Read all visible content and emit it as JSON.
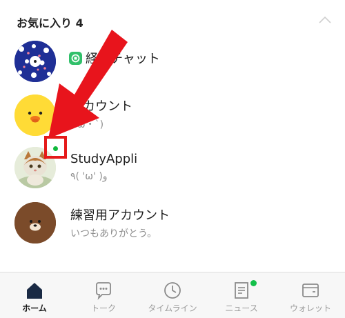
{
  "favorites": {
    "title": "お気に入り 4",
    "collapse_icon": "chevron-up-icon"
  },
  "friends": [
    {
      "name": "経験チャット",
      "status": "",
      "avatar": "pattern-avatar"
    },
    {
      "name": "アカウント",
      "status": "( ω・`)",
      "avatar": "chick-avatar"
    },
    {
      "name": "StudyAppli",
      "status": "٩( 'ω' )و",
      "avatar": "kitten-photo-avatar",
      "online": true
    },
    {
      "name": "練習用アカウント",
      "status": "いつもありがとう。",
      "avatar": "bear-avatar"
    }
  ],
  "tabs": [
    {
      "label": "ホーム",
      "icon": "home-icon",
      "active": true
    },
    {
      "label": "トーク",
      "icon": "chat-bubble-icon"
    },
    {
      "label": "タイムライン",
      "icon": "clock-icon"
    },
    {
      "label": "ニュース",
      "icon": "news-icon",
      "badge": true
    },
    {
      "label": "ウォレット",
      "icon": "wallet-icon"
    }
  ],
  "colors": {
    "highlight": "#e51a1a",
    "online": "#10b83c",
    "badge_green": "#31c06a",
    "active_tab": "#1a1a1a",
    "inactive_tab": "#9a9a9a"
  }
}
